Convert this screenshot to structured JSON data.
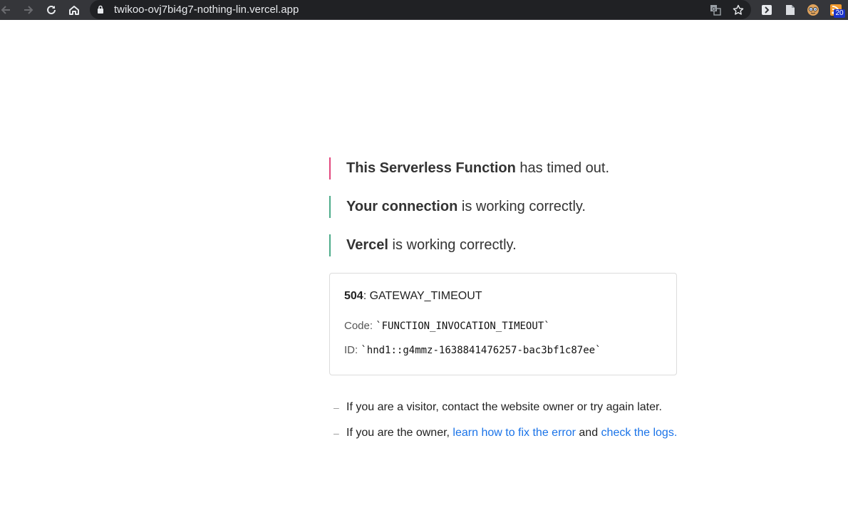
{
  "browser": {
    "url": "twikoo-ovj7bi4g7-nothing-lin.vercel.app",
    "extension_badge": "20"
  },
  "status_lines": [
    {
      "bold": "This Serverless Function",
      "rest": " has timed out.",
      "color": "#e2477d"
    },
    {
      "bold": "Your connection",
      "rest": " is working correctly.",
      "color": "#4dab8a"
    },
    {
      "bold": "Vercel",
      "rest": " is working correctly.",
      "color": "#4dab8a"
    }
  ],
  "error": {
    "status_code": "504",
    "status_sep": ": ",
    "status_name": "GATEWAY_TIMEOUT",
    "code_label": "Code: ",
    "code_value": "`FUNCTION_INVOCATION_TIMEOUT`",
    "id_label": "ID: ",
    "id_value": "`hnd1::g4mmz-1638841476257-bac3bf1c87ee`"
  },
  "tips": {
    "dash": "–",
    "visitor": "If you are a visitor, contact the website owner or try again later.",
    "owner_prefix": "If you are the owner, ",
    "owner_link1": "learn how to fix the error",
    "owner_mid": " and ",
    "owner_link2": "check the logs",
    "owner_suffix": "."
  },
  "colors": {
    "toolbar": "#35363a",
    "omnibox": "#202124",
    "link": "#1a73e8"
  }
}
